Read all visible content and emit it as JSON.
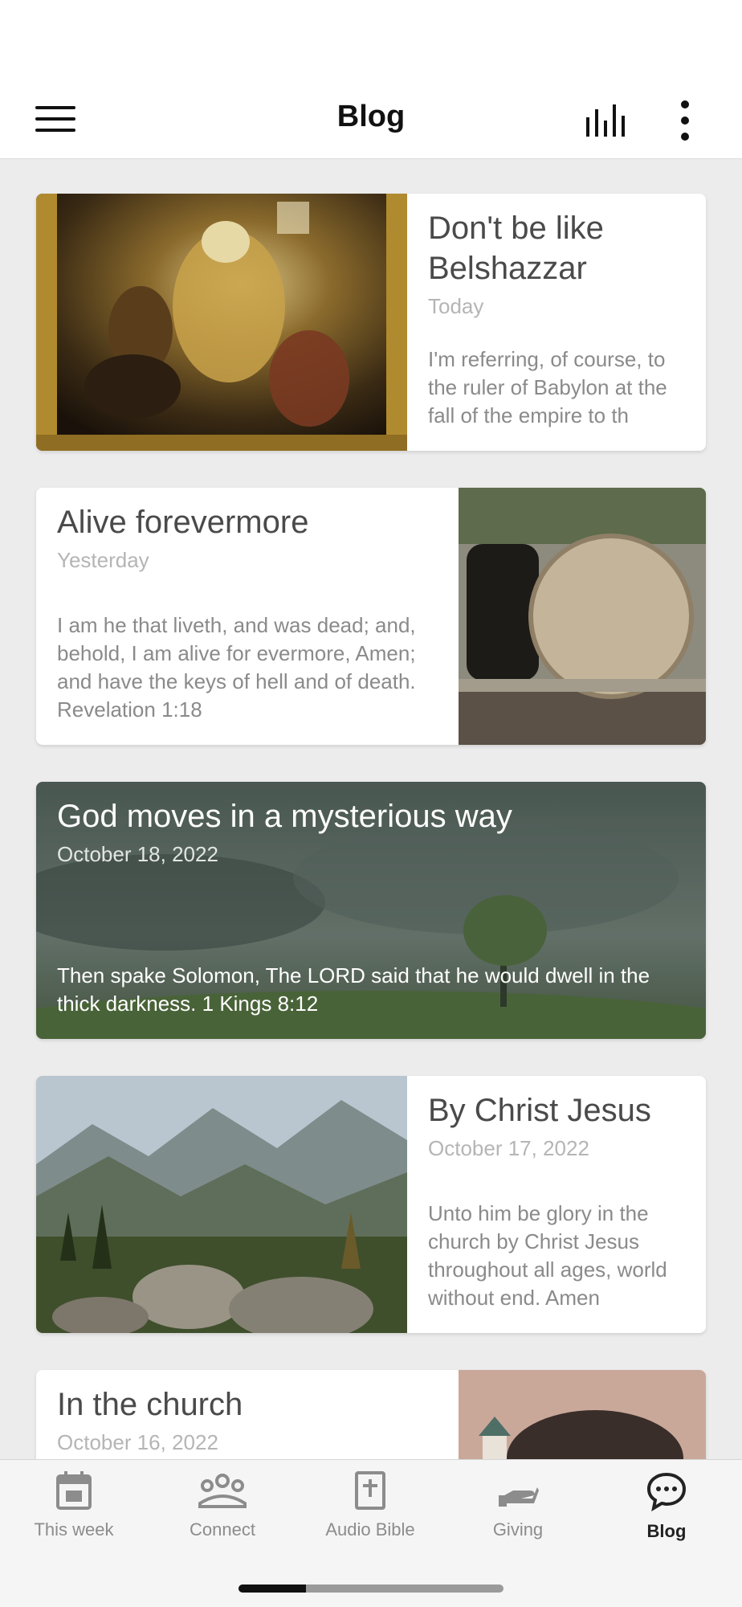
{
  "header": {
    "title": "Blog",
    "menu_icon": "hamburger-menu-icon",
    "audio_icon": "audio-bars-icon",
    "more_icon": "more-vertical-icon"
  },
  "posts": [
    {
      "title": "Don't be like Belshazzar",
      "date": "Today",
      "excerpt": "I'm referring, of course, to the ruler of Babylon at the fall of the empire to th",
      "image": "painting-feast-of-belshazzar",
      "layout": "image-left"
    },
    {
      "title": "Alive forevermore",
      "date": "Yesterday",
      "excerpt": "I am he that liveth, and was dead; and, behold, I am alive for evermore, Amen; and have the keys of hell and of death.  Revelation 1:18",
      "image": "photo-empty-tomb-stone",
      "layout": "image-right"
    },
    {
      "title": "God moves in a mysterious way",
      "date": "October 18, 2022",
      "excerpt": "Then spake Solomon, The LORD said that he would dwell in the thick darkness.  1 Kings 8:12",
      "image": "photo-storm-clouds-tree",
      "layout": "image-full"
    },
    {
      "title": "By Christ Jesus",
      "date": "October 17, 2022",
      "excerpt": "Unto him be glory in the church by Christ Jesus throughout all ages, world without end. Amen",
      "image": "photo-mountain-valley",
      "layout": "image-left"
    },
    {
      "title": "In the church",
      "date": "October 16, 2022",
      "excerpt": "",
      "image": "photo-tree-and-chapel",
      "layout": "image-right"
    }
  ],
  "bottom_nav": [
    {
      "label": "This week",
      "icon": "calendar-icon",
      "active": false
    },
    {
      "label": "Connect",
      "icon": "people-group-icon",
      "active": false
    },
    {
      "label": "Audio Bible",
      "icon": "bible-book-icon",
      "active": false
    },
    {
      "label": "Giving",
      "icon": "giving-hand-icon",
      "active": false
    },
    {
      "label": "Blog",
      "icon": "chat-bubble-icon",
      "active": true
    }
  ],
  "colors": {
    "background": "#ececec",
    "card": "#ffffff",
    "title_text": "#4a4a4a",
    "date_text": "#b5b5b5",
    "excerpt_text": "#8a8a8a",
    "nav_inactive": "#8c8c8c",
    "nav_active": "#222222"
  }
}
